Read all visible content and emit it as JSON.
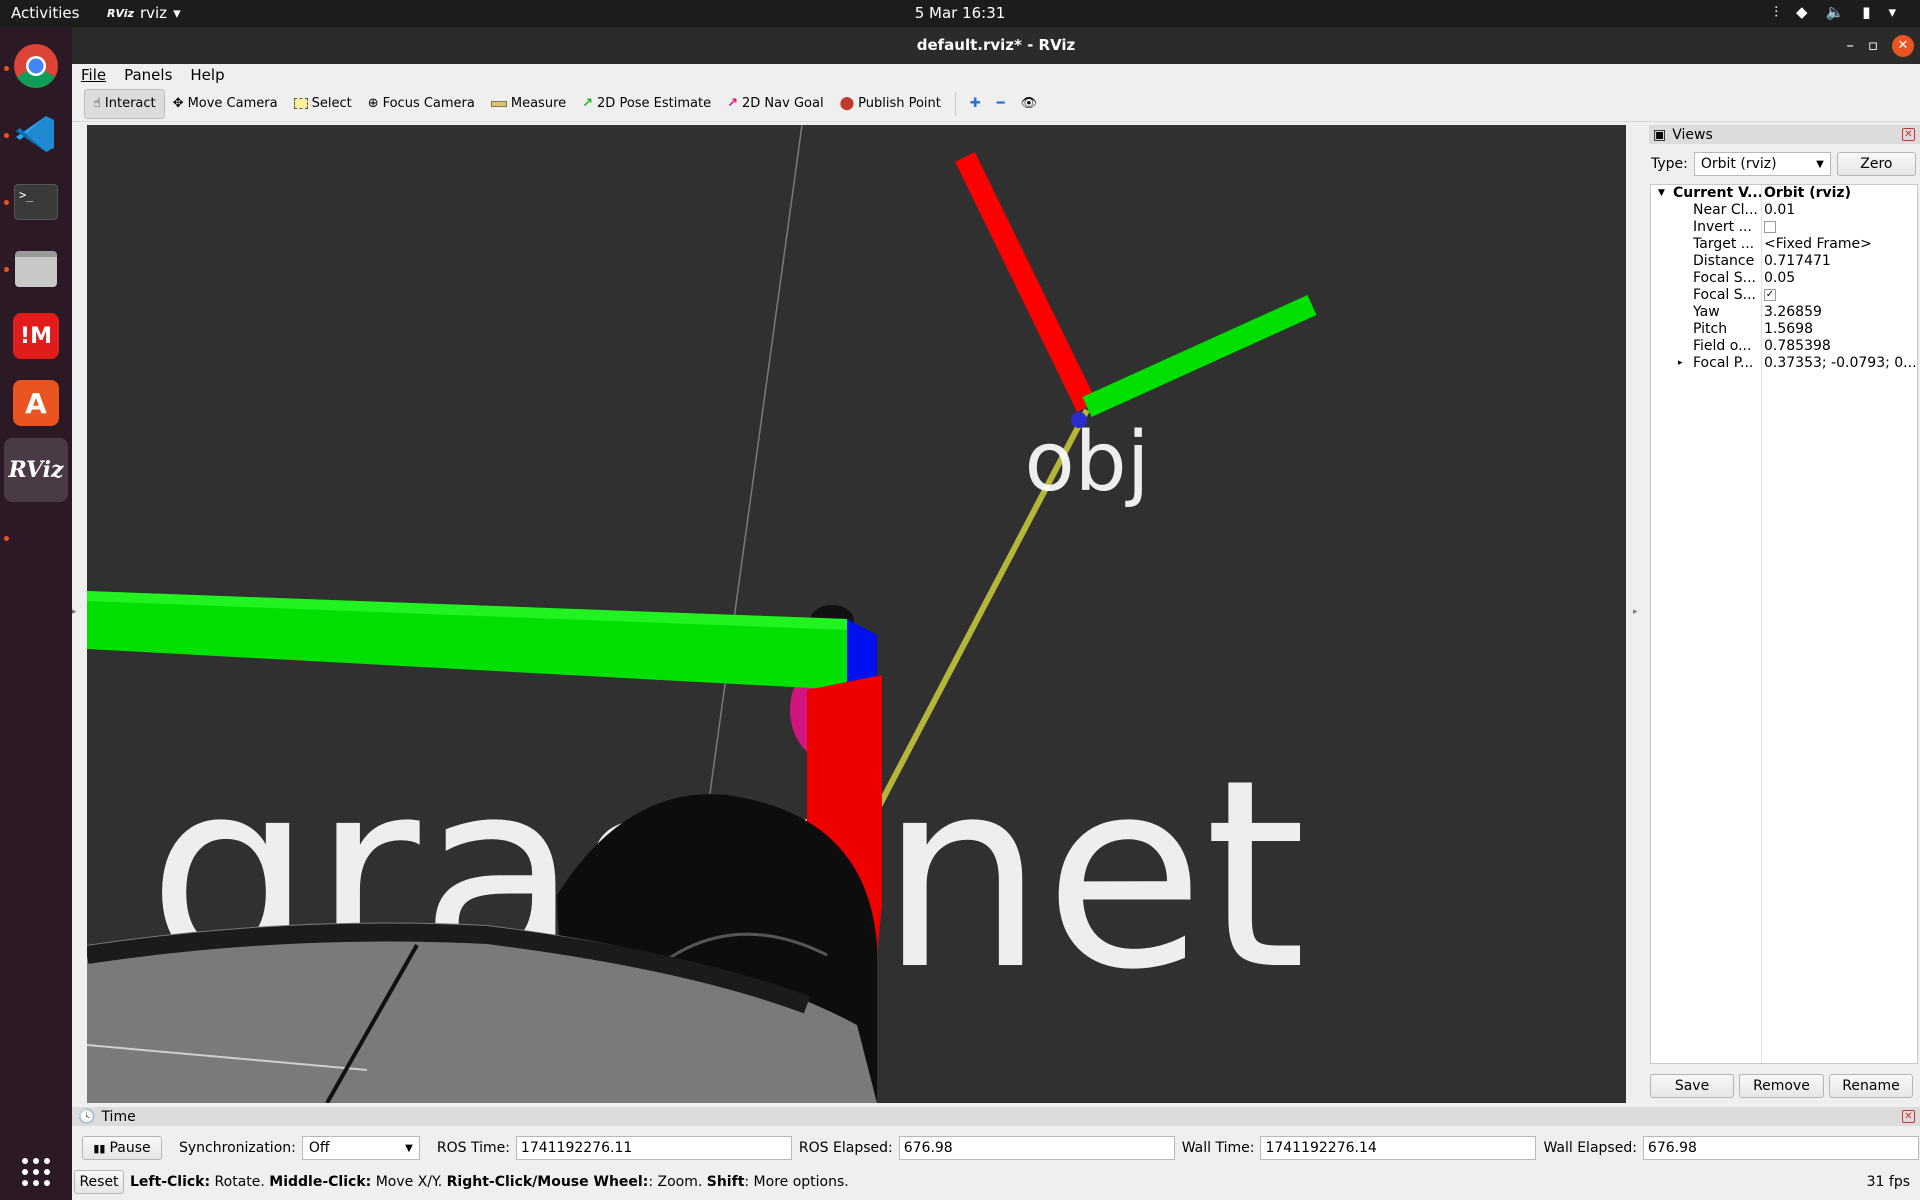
{
  "topbar": {
    "activities": "Activities",
    "app_name": "rviz",
    "app_icon_text": "RViz",
    "clock": "5 Mar  16:31"
  },
  "dock": {
    "items": [
      "Google Chrome",
      "Visual Studio Code",
      "Terminal",
      "Files",
      "Mission Center",
      "Ubuntu Software",
      "RViz"
    ],
    "rviz_label": "RViz",
    "terminal_label": ">_"
  },
  "window": {
    "title": "default.rviz* - RViz",
    "menu": [
      "File",
      "Panels",
      "Help"
    ]
  },
  "toolbar": {
    "interact": "Interact",
    "move_camera": "Move Camera",
    "select": "Select",
    "focus_camera": "Focus Camera",
    "measure": "Measure",
    "pose_estimate": "2D Pose Estimate",
    "nav_goal": "2D Nav Goal",
    "publish_point": "Publish Point"
  },
  "scene": {
    "label_obj": "obj",
    "label_graspnet": "graspnet",
    "colors": {
      "x_axis": "#ff0000",
      "y_axis": "#00ff00",
      "z_axis": "#0000ff",
      "link": "#b5b53a",
      "background": "#303030"
    }
  },
  "views": {
    "title": "Views",
    "type_label": "Type:",
    "type_value": "Orbit (rviz)",
    "zero_label": "Zero",
    "properties": [
      {
        "key": "Current V...",
        "value": "Orbit (rviz)"
      },
      {
        "key": "Near Cl...",
        "value": "0.01"
      },
      {
        "key": "Invert ...",
        "value": ""
      },
      {
        "key": "Target ...",
        "value": "<Fixed Frame>"
      },
      {
        "key": "Distance",
        "value": "0.717471"
      },
      {
        "key": "Focal S...",
        "value": "0.05"
      },
      {
        "key": "Focal S...",
        "value": "✓"
      },
      {
        "key": "Yaw",
        "value": "3.26859"
      },
      {
        "key": "Pitch",
        "value": "1.5698"
      },
      {
        "key": "Field o...",
        "value": "0.785398"
      },
      {
        "key": "Focal P...",
        "value": "0.37353; -0.0793; 0...."
      }
    ],
    "save_label": "Save",
    "remove_label": "Remove",
    "rename_label": "Rename"
  },
  "time": {
    "title": "Time",
    "pause_label": "Pause",
    "sync_label": "Synchronization:",
    "sync_value": "Off",
    "ros_time_label": "ROS Time:",
    "ros_time_value": "1741192276.11",
    "ros_elapsed_label": "ROS Elapsed:",
    "ros_elapsed_value": "676.98",
    "wall_time_label": "Wall Time:",
    "wall_time_value": "1741192276.14",
    "wall_elapsed_label": "Wall Elapsed:",
    "wall_elapsed_value": "676.98"
  },
  "status": {
    "reset_label": "Reset",
    "hint_left_b": "Left-Click:",
    "hint_left": " Rotate. ",
    "hint_mid_b": "Middle-Click:",
    "hint_mid": " Move X/Y. ",
    "hint_right_b": "Right-Click/Mouse Wheel:",
    "hint_right": ": Zoom. ",
    "hint_shift_b": "Shift",
    "hint_shift": ": More options.",
    "fps": "31 fps"
  }
}
